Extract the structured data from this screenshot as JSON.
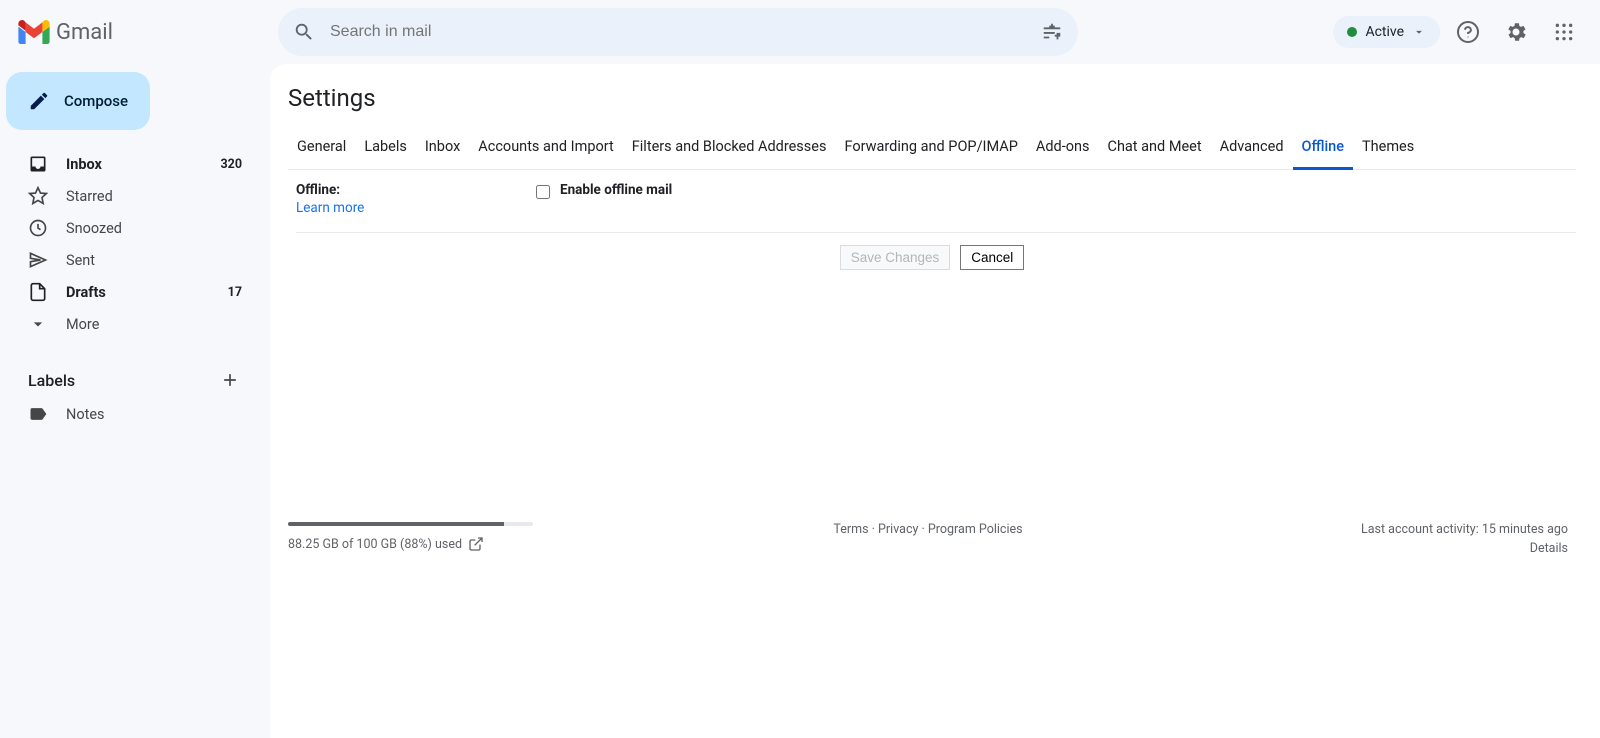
{
  "header": {
    "product_name": "Gmail",
    "search_placeholder": "Search in mail",
    "status_label": "Active"
  },
  "sidebar": {
    "compose_label": "Compose",
    "items": [
      {
        "label": "Inbox",
        "count": "320",
        "bold": true
      },
      {
        "label": "Starred",
        "count": "",
        "bold": false
      },
      {
        "label": "Snoozed",
        "count": "",
        "bold": false
      },
      {
        "label": "Sent",
        "count": "",
        "bold": false
      },
      {
        "label": "Drafts",
        "count": "17",
        "bold": true
      },
      {
        "label": "More",
        "count": "",
        "bold": false
      }
    ],
    "labels_heading": "Labels",
    "user_labels": [
      {
        "label": "Notes"
      }
    ]
  },
  "settings": {
    "title": "Settings",
    "tabs": [
      "General",
      "Labels",
      "Inbox",
      "Accounts and Import",
      "Filters and Blocked Addresses",
      "Forwarding and POP/IMAP",
      "Add-ons",
      "Chat and Meet",
      "Advanced",
      "Offline",
      "Themes"
    ],
    "active_tab_index": 9,
    "offline": {
      "label": "Offline:",
      "learn_more": "Learn more",
      "checkbox_label": "Enable offline mail",
      "checked": false
    },
    "save_button": "Save Changes",
    "cancel_button": "Cancel"
  },
  "footer": {
    "storage_percent": 88,
    "storage_text": "88.25 GB of 100 GB (88%) used",
    "links": {
      "terms": "Terms",
      "privacy": "Privacy",
      "policies": "Program Policies"
    },
    "activity": "Last account activity: 15 minutes ago",
    "details": "Details"
  }
}
